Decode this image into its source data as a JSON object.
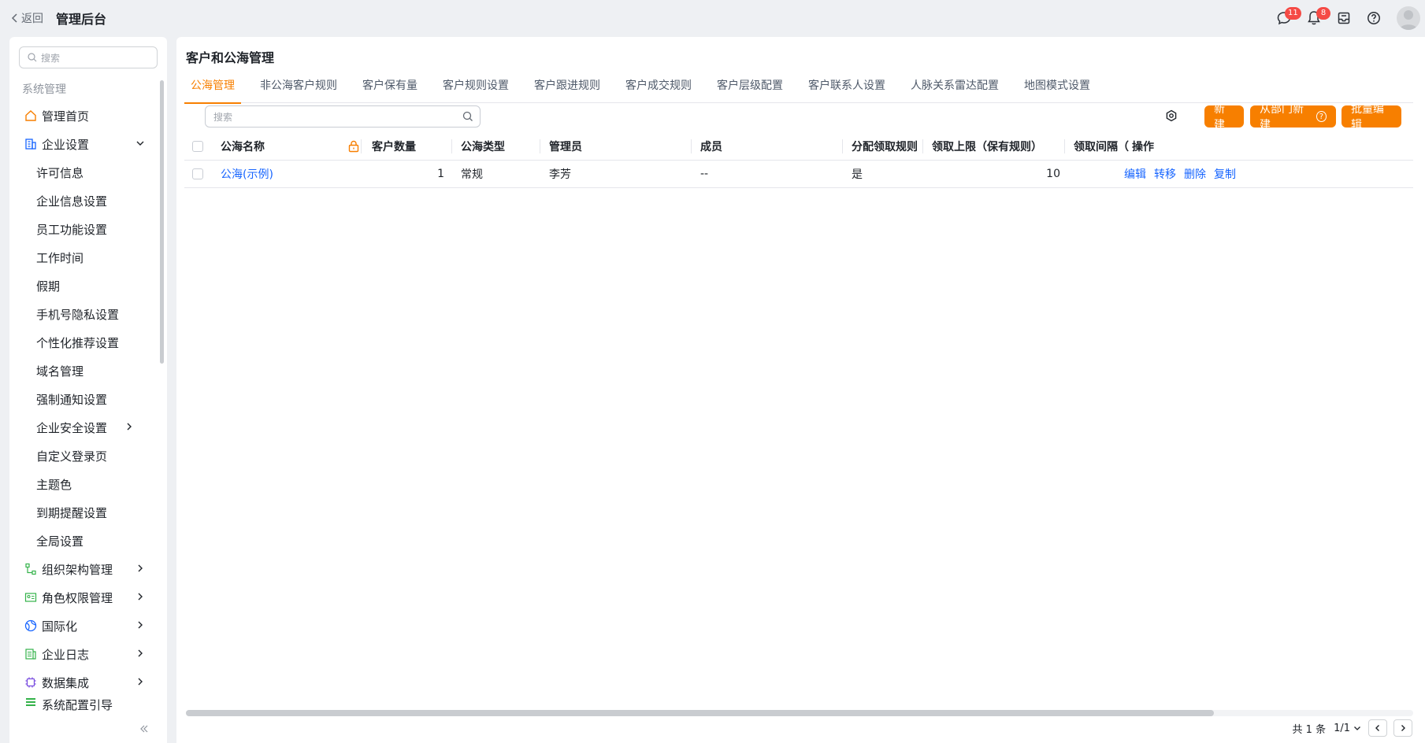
{
  "header": {
    "back_label": "返回",
    "title": "管理后台",
    "chat_badge": "11",
    "notify_badge": "8"
  },
  "sidebar": {
    "search_placeholder": "搜索",
    "section_label": "系统管理",
    "items": [
      {
        "label": "管理首页",
        "icon": "home-icon"
      },
      {
        "label": "企业设置",
        "icon": "building-icon"
      },
      {
        "label": "许可信息"
      },
      {
        "label": "企业信息设置"
      },
      {
        "label": "员工功能设置"
      },
      {
        "label": "工作时间"
      },
      {
        "label": "假期"
      },
      {
        "label": "手机号隐私设置"
      },
      {
        "label": "个性化推荐设置"
      },
      {
        "label": "域名管理"
      },
      {
        "label": "强制通知设置"
      },
      {
        "label": "企业安全设置"
      },
      {
        "label": "自定义登录页"
      },
      {
        "label": "主题色"
      },
      {
        "label": "到期提醒设置"
      },
      {
        "label": "全局设置"
      },
      {
        "label": "组织架构管理",
        "icon": "org-icon"
      },
      {
        "label": "角色权限管理",
        "icon": "role-icon"
      },
      {
        "label": "国际化",
        "icon": "globe-icon"
      },
      {
        "label": "企业日志",
        "icon": "log-icon"
      },
      {
        "label": "数据集成",
        "icon": "chip-icon"
      },
      {
        "label": "系统配置引导",
        "icon": "guide-icon"
      }
    ]
  },
  "main": {
    "title": "客户和公海管理",
    "tabs": [
      "公海管理",
      "非公海客户规则",
      "客户保有量",
      "客户规则设置",
      "客户跟进规则",
      "客户成交规则",
      "客户层级配置",
      "客户联系人设置",
      "人脉关系雷达配置",
      "地图模式设置"
    ],
    "search_placeholder": "搜索",
    "buttons": {
      "new": "新建",
      "from_dept": "从部门新建",
      "batch_edit": "批量编辑"
    },
    "columns": [
      "公海名称",
      "客户数量",
      "公海类型",
      "管理员",
      "成员",
      "分配领取规则",
      "领取上限（保有规则）",
      "领取间隔（",
      "操作"
    ],
    "rows": [
      {
        "name": "公海(示例)",
        "count": "1",
        "type": "常规",
        "admin": "李芳",
        "members": "--",
        "assign_rule": "是",
        "limit": "10",
        "interval": "",
        "ops": [
          "编辑",
          "转移",
          "删除",
          "复制"
        ]
      }
    ],
    "pager": {
      "total": "共 1 条",
      "page": "1/1"
    }
  },
  "colors": {
    "accent": "#f77f00",
    "link": "#1664ff",
    "badge": "#f54a45"
  }
}
